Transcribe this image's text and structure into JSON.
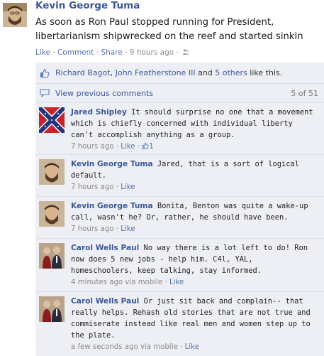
{
  "post": {
    "author": "Kevin George Tuma",
    "text_line1": "As soon as Ron Paul stopped running for President,",
    "text_line2": "libertarianism shipwrecked on the reef and started sinkin",
    "like": "Like",
    "comment": "Comment",
    "share": "Share",
    "time": "9 hours ago",
    "privacy_icon": "friends-icon"
  },
  "likes": {
    "name1": "Richard Bagot",
    "name2": "John Featherstone III",
    "and": "and",
    "others": "5 others",
    "suffix": "like this.",
    "icon": "thumbs-up-icon"
  },
  "view_previous": {
    "label": "View previous comments",
    "count": "5 of 51",
    "icon": "comment-bubble-icon"
  },
  "comments": [
    {
      "author": "Jared Shipley",
      "text": "It should surprise no one that a movement which is chiefly concerned with individual liberty can't accomplish anything as a group.",
      "time": "7 hours ago",
      "like": "Like",
      "likes": "1",
      "avatar": "confederate-flag"
    },
    {
      "author": "Kevin George Tuma",
      "text": "Jared, that is a sort of logical default.",
      "time": "7 hours ago",
      "like": "Like",
      "avatar": "bearded-man"
    },
    {
      "author": "Kevin George Tuma",
      "text": "Bonita, Benton was quite a wake-up call, wasn't he? Or, rather, he should have been.",
      "time": "7 hours ago",
      "like": "Like",
      "avatar": "bearded-man"
    },
    {
      "author": "Carol Wells Paul",
      "text": "No way there is a lot left to do! Ron now does 5 new jobs - help him. C4l, YAL, homeschoolers, keep talking, stay informed.",
      "time": "4 minutes ago via mobile",
      "like": "Like",
      "avatar": "couple"
    },
    {
      "author": "Carol Wells Paul",
      "text": "Or just sit back and complain-- that really helps. Rehash old stories that are not true and commiserate instead like real men and women step up to the plate.",
      "time": "a few seconds ago via mobile",
      "like": "Like",
      "avatar": "couple"
    }
  ],
  "colors": {
    "link": "#3b5998",
    "feedback_bg": "#edeff4",
    "meta_gray": "#8a8a8a"
  }
}
